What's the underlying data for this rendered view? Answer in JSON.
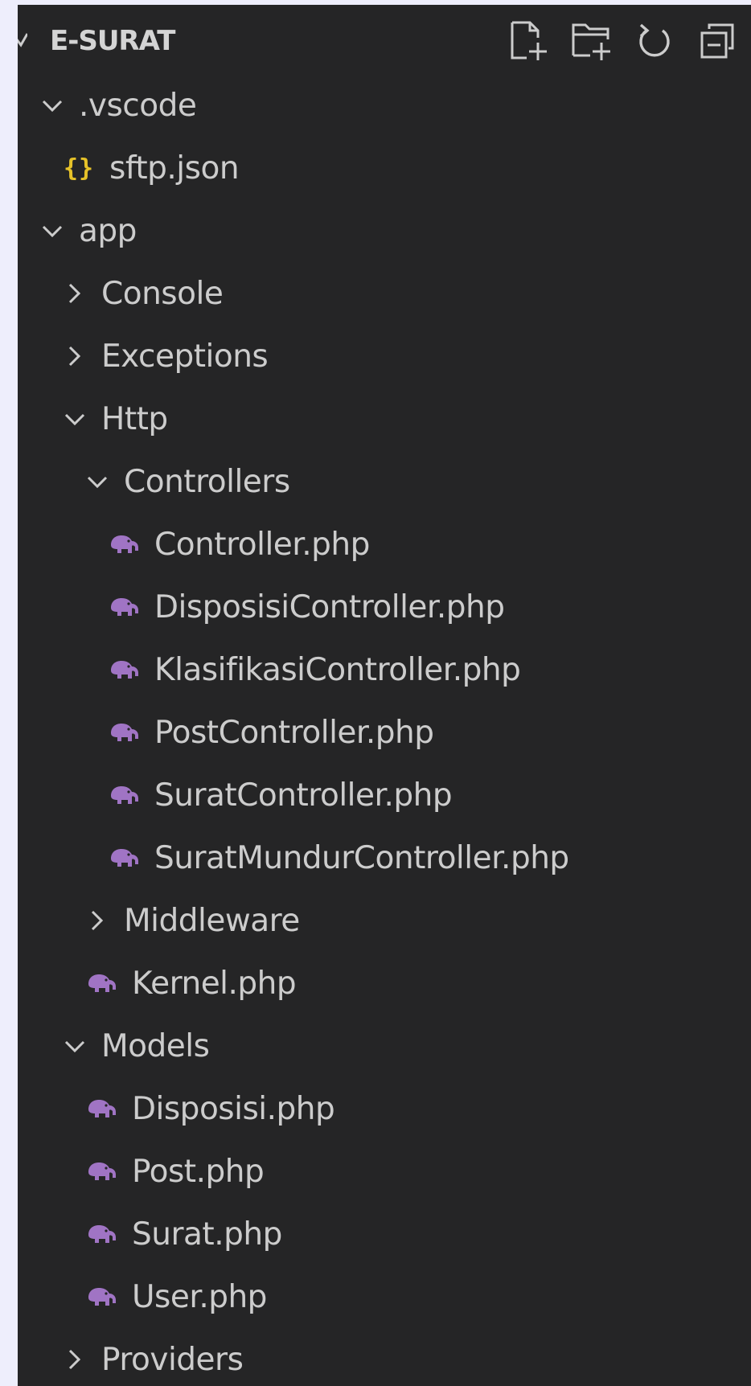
{
  "explorer": {
    "title": "E-SURAT",
    "actions": [
      {
        "name": "new-file-icon"
      },
      {
        "name": "new-folder-icon"
      },
      {
        "name": "refresh-icon"
      },
      {
        "name": "collapse-all-icon"
      }
    ]
  },
  "tree": [
    {
      "label": ".vscode",
      "type": "folder",
      "expanded": true,
      "depth": 0
    },
    {
      "label": "sftp.json",
      "type": "json",
      "depth": 1
    },
    {
      "label": "app",
      "type": "folder",
      "expanded": true,
      "depth": 0
    },
    {
      "label": "Console",
      "type": "folder",
      "expanded": false,
      "depth": 1
    },
    {
      "label": "Exceptions",
      "type": "folder",
      "expanded": false,
      "depth": 1
    },
    {
      "label": "Http",
      "type": "folder",
      "expanded": true,
      "depth": 1
    },
    {
      "label": "Controllers",
      "type": "folder",
      "expanded": true,
      "depth": 2
    },
    {
      "label": "Controller.php",
      "type": "php",
      "depth": 3
    },
    {
      "label": "DisposisiController.php",
      "type": "php",
      "depth": 3
    },
    {
      "label": "KlasifikasiController.php",
      "type": "php",
      "depth": 3
    },
    {
      "label": "PostController.php",
      "type": "php",
      "depth": 3
    },
    {
      "label": "SuratController.php",
      "type": "php",
      "depth": 3
    },
    {
      "label": "SuratMundurController.php",
      "type": "php",
      "depth": 3
    },
    {
      "label": "Middleware",
      "type": "folder",
      "expanded": false,
      "depth": 2
    },
    {
      "label": "Kernel.php",
      "type": "php",
      "depth": 2
    },
    {
      "label": "Models",
      "type": "folder",
      "expanded": true,
      "depth": 1
    },
    {
      "label": "Disposisi.php",
      "type": "php",
      "depth": 2
    },
    {
      "label": "Post.php",
      "type": "php",
      "depth": 2
    },
    {
      "label": "Surat.php",
      "type": "php",
      "depth": 2
    },
    {
      "label": "User.php",
      "type": "php",
      "depth": 2
    },
    {
      "label": "Providers",
      "type": "folder",
      "expanded": false,
      "depth": 1
    }
  ],
  "colors": {
    "background": "#252526",
    "page": "#eeeefc",
    "text": "#cccccc",
    "php_icon": "#a074c4",
    "json_icon": "#e6c229"
  },
  "icons": {
    "php": "php-elephant-icon",
    "json": "json-braces-icon",
    "folder_open": "chevron-down-icon",
    "folder_closed": "chevron-right-icon"
  }
}
